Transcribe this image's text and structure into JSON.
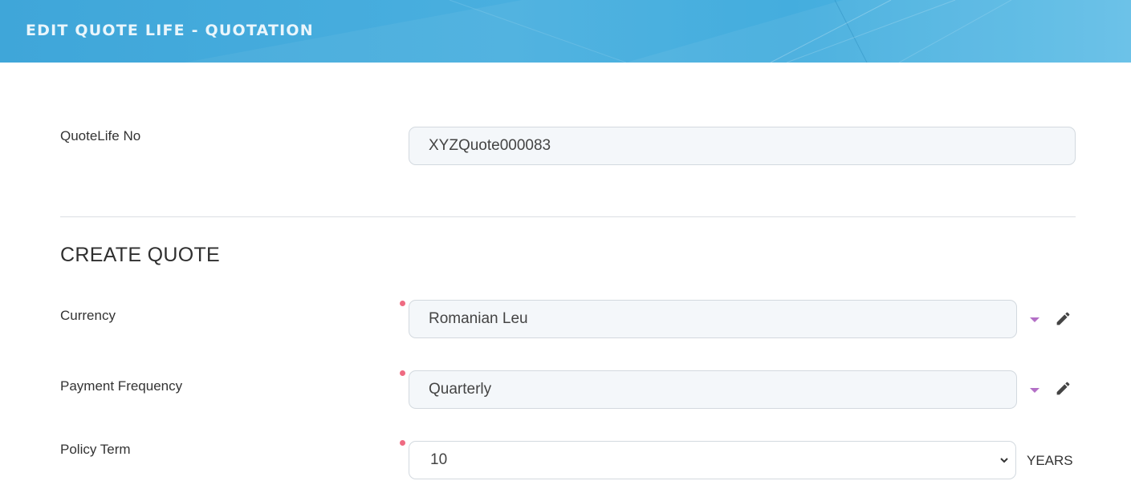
{
  "header": {
    "title": "EDIT QUOTE LIFE - QUOTATION"
  },
  "quote_no": {
    "label": "QuoteLife No",
    "value": "XYZQuote000083"
  },
  "section": {
    "title": "CREATE QUOTE"
  },
  "currency": {
    "label": "Currency",
    "value": "Romanian Leu",
    "required": true
  },
  "payment_frequency": {
    "label": "Payment Frequency",
    "value": "Quarterly",
    "required": true
  },
  "policy_term": {
    "label": "Policy Term",
    "value": "10",
    "unit": "YEARS",
    "required": true
  },
  "colors": {
    "header_bg": "#3fa6d9",
    "required_dot": "#ef6b82",
    "dropdown_caret": "#b36fc6"
  },
  "icons": {
    "dropdown": "caret-down-icon",
    "edit": "pencil-icon",
    "select": "chevron-down-icon"
  }
}
